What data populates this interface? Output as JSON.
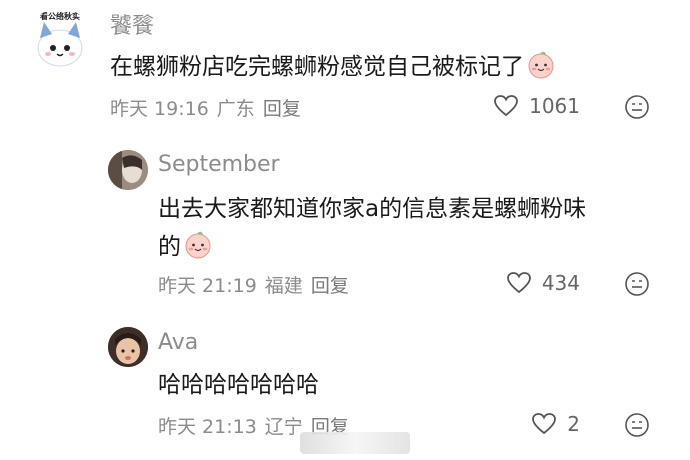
{
  "comments": [
    {
      "username": "饕餮",
      "avatar_caption": "看公络秋实",
      "text": "在螺狮粉店吃完螺蛳粉感觉自己被标记了",
      "time": "昨天 19:16",
      "location": "广东",
      "reply_label": "回复",
      "likes": "1061"
    },
    {
      "username": "September",
      "text_line1": "出去大家都知道你家a的信息素是螺蛳粉味",
      "text_line2": "的",
      "time": "昨天 21:19",
      "location": "福建",
      "reply_label": "回复",
      "likes": "434"
    },
    {
      "username": "Ava",
      "text": "哈哈哈哈哈哈哈",
      "time": "昨天 21:13",
      "location": "辽宁",
      "reply_label": "回复",
      "likes": "2"
    }
  ],
  "icons": {
    "like": "heart-icon",
    "emoji": "emoji-face-icon",
    "inline_emoji": "blushing-face-emoji"
  },
  "colors": {
    "text": "#1a1a1a",
    "muted": "#8c8c8c",
    "emoji_pink": "#f4a59c"
  }
}
